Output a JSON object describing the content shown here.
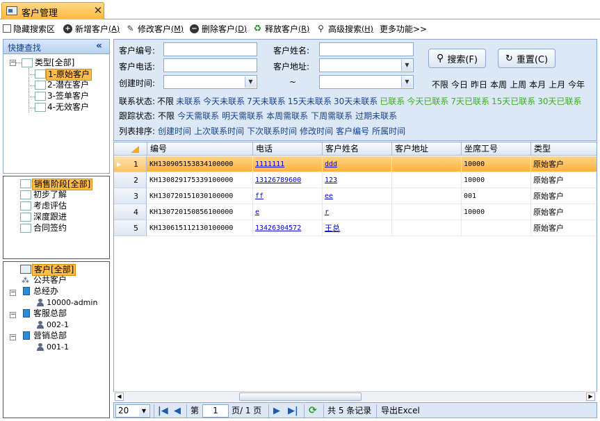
{
  "tab": {
    "title": "客户管理",
    "close": "✕"
  },
  "toolbar": {
    "hide_search": "隐藏搜索区",
    "add": {
      "label": "新增客户",
      "key": "(A)"
    },
    "edit": {
      "label": "修改客户",
      "key": "(M)"
    },
    "delete": {
      "label": "删除客户",
      "key": "(D)"
    },
    "release": {
      "label": "释放客户",
      "key": "(R)"
    },
    "adv_search": {
      "label": "高级搜索",
      "key": "(H)"
    },
    "more": "更多功能>>"
  },
  "quick": {
    "title": "快捷查找",
    "collapse": "«",
    "type_root": "类型[全部]",
    "types": [
      "1-原始客户",
      "2-潜在客户",
      "3-签单客户",
      "4-无效客户"
    ],
    "stage_root": "销售阶段[全部]",
    "stages": [
      "初步了解",
      "考虑评估",
      "深度跟进",
      "合同签约"
    ],
    "cust_root": "客户[全部]",
    "public": "公共客户",
    "depts": [
      {
        "name": "总经办",
        "user": "10000-admin"
      },
      {
        "name": "客服总部",
        "user": "002-1"
      },
      {
        "name": "营销总部",
        "user": "001-1"
      }
    ]
  },
  "search": {
    "cust_no_label": "客户编号:",
    "cust_name_label": "客户姓名:",
    "phone_label": "客户电话:",
    "address_label": "客户地址:",
    "created_label": "创建时间:",
    "tilde": "~",
    "search_btn": "搜索(F)",
    "reset_btn": "重置(C)",
    "date_quick": [
      "不限",
      "今日",
      "昨日",
      "本周",
      "上周",
      "本月",
      "上月",
      "今年"
    ],
    "contact_label": "联系状态:",
    "contact_blue": [
      "不限",
      "未联系",
      "今天未联系",
      "7天未联系",
      "15天未联系",
      "30天未联系"
    ],
    "contact_green": [
      "已联系",
      "今天已联系",
      "7天已联系",
      "15天已联系",
      "30天已联系"
    ],
    "follow_label": "跟踪状态:",
    "follow": [
      "不限",
      "今天需联系",
      "明天需联系",
      "本周需联系",
      "下周需联系",
      "过期未联系"
    ],
    "sort_label": "列表排序:",
    "sort": [
      "创建时间",
      "上次联系时间",
      "下次联系时间",
      "修改时间",
      "客户编号",
      "所属时间"
    ]
  },
  "grid": {
    "columns": [
      "编号",
      "电话",
      "客户姓名",
      "客户地址",
      "坐席工号",
      "类型"
    ],
    "rows": [
      {
        "n": "1",
        "no": "KH130905153834100000",
        "phone": "1111111",
        "name": "ddd",
        "addr": "",
        "agent": "10000",
        "type": "原始客户"
      },
      {
        "n": "2",
        "no": "KH130829175339100000",
        "phone": "13126789600",
        "name": "123",
        "addr": "",
        "agent": "10000",
        "type": "原始客户"
      },
      {
        "n": "3",
        "no": "KH130720151030100000",
        "phone": "ff",
        "name": "ee",
        "addr": "",
        "agent": "001",
        "type": "原始客户"
      },
      {
        "n": "4",
        "no": "KH130720150856100000",
        "phone": "e",
        "name": "r",
        "addr": "",
        "agent": "10000",
        "type": "原始客户"
      },
      {
        "n": "5",
        "no": "KH130615112130100000",
        "phone": "13426304572",
        "name": "王总",
        "addr": "",
        "agent": "",
        "type": "原始客户"
      }
    ]
  },
  "pager": {
    "page_size": "20",
    "page_prefix": "第",
    "page": "1",
    "page_suffix": "页/ 1 页",
    "total": "共 5 条记录",
    "export": "导出Excel"
  }
}
